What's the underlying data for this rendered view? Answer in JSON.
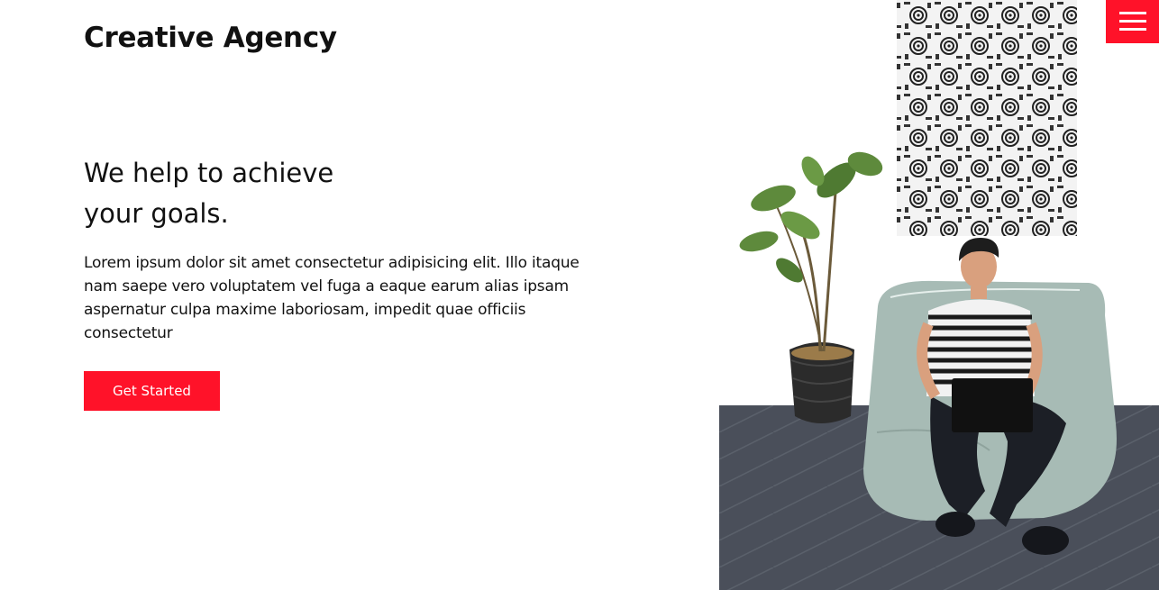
{
  "header": {
    "logo_text": "Creative Agency",
    "menu_icon": "hamburger-menu-icon"
  },
  "hero": {
    "title_line1": "We help to achieve",
    "title_line2": "your goals.",
    "description": "Lorem ipsum dolor sit amet consectetur adipisicing elit. Illo itaque nam saepe vero voluptatem vel fuga a eaque earum alias ipsam aspernatur culpa maxime laboriosam, impedit quae officiis consectetur",
    "cta_label": "Get Started"
  },
  "colors": {
    "accent": "#ff1229",
    "text": "#111111",
    "background": "#ffffff"
  }
}
